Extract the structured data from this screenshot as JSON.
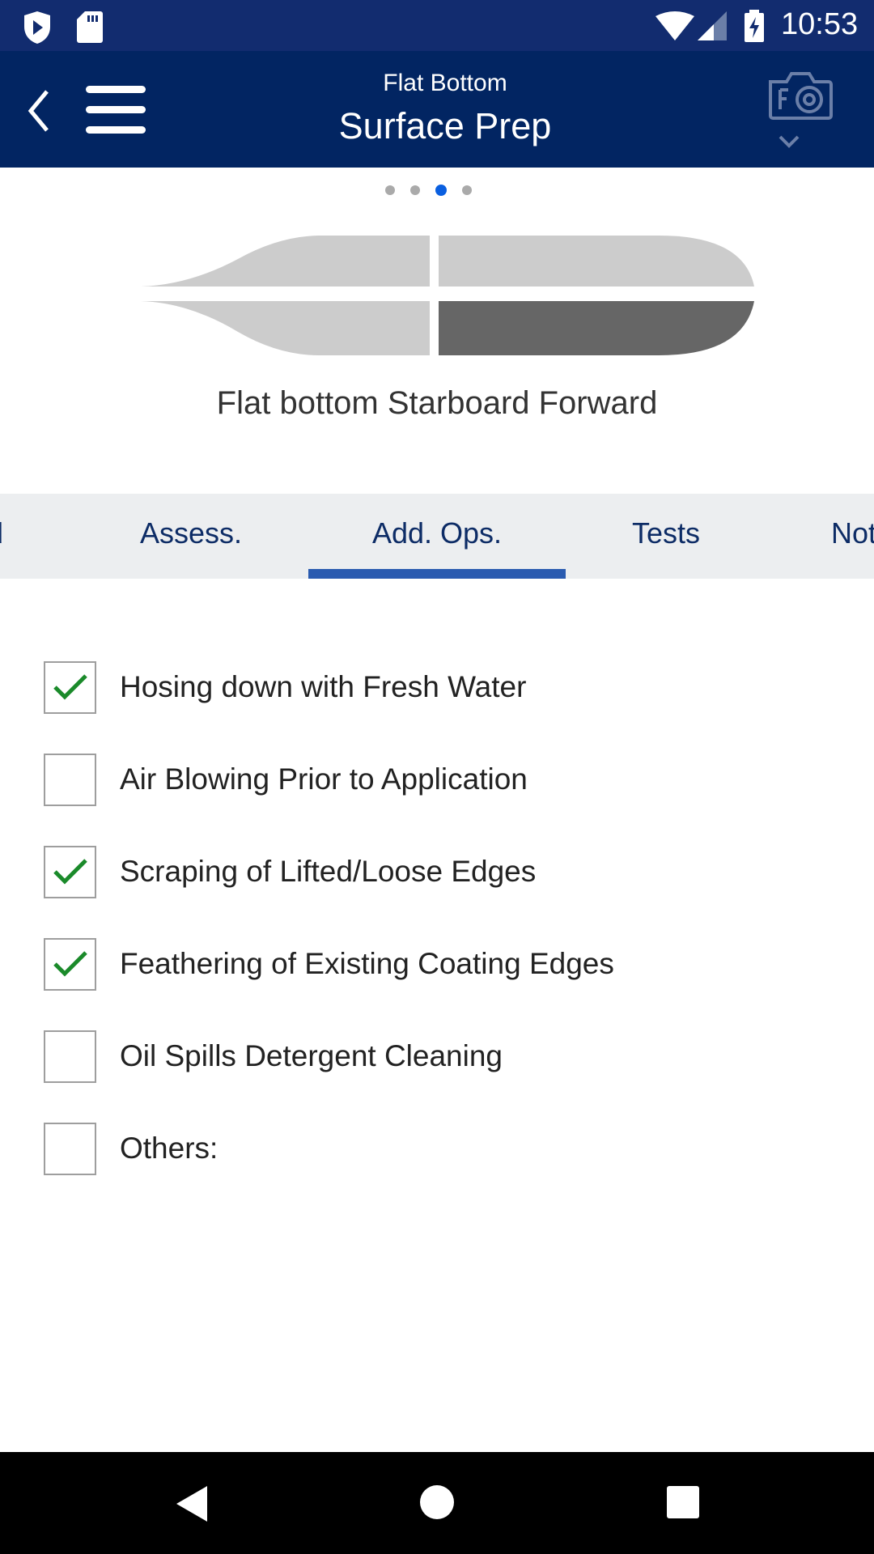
{
  "status_bar": {
    "time": "10:53",
    "icons": [
      "shield-play-icon",
      "sd-card-icon",
      "wifi-icon",
      "signal-icon",
      "battery-charging-icon"
    ]
  },
  "toolbar": {
    "subtitle": "Flat Bottom",
    "title": "Surface Prep",
    "icons": [
      "back-icon",
      "menu-icon",
      "camera-icon",
      "chevron-down-icon"
    ]
  },
  "pager": {
    "count": 4,
    "active": 3,
    "active_color": "#0a5fe0"
  },
  "diagram": {
    "caption": "Flat bottom Starboard Forward",
    "highlight_section": "starboard-forward"
  },
  "tabs": [
    {
      "label": "d"
    },
    {
      "label": "Assess."
    },
    {
      "label": "Add. Ops."
    },
    {
      "label": "Tests"
    },
    {
      "label": "Not"
    }
  ],
  "active_tab": "Add. Ops.",
  "checklist": [
    {
      "label": "Hosing down with Fresh Water",
      "checked": true
    },
    {
      "label": "Air Blowing Prior to Application",
      "checked": false
    },
    {
      "label": "Scraping of Lifted/Loose Edges",
      "checked": true
    },
    {
      "label": "Feathering of Existing Coating Edges",
      "checked": true
    },
    {
      "label": "Oil Spills Detergent Cleaning",
      "checked": false
    },
    {
      "label": "Others:",
      "checked": false
    }
  ],
  "colors": {
    "header": "#022562",
    "tab_indicator": "#2a5bb0",
    "check": "#1a8a2a"
  }
}
